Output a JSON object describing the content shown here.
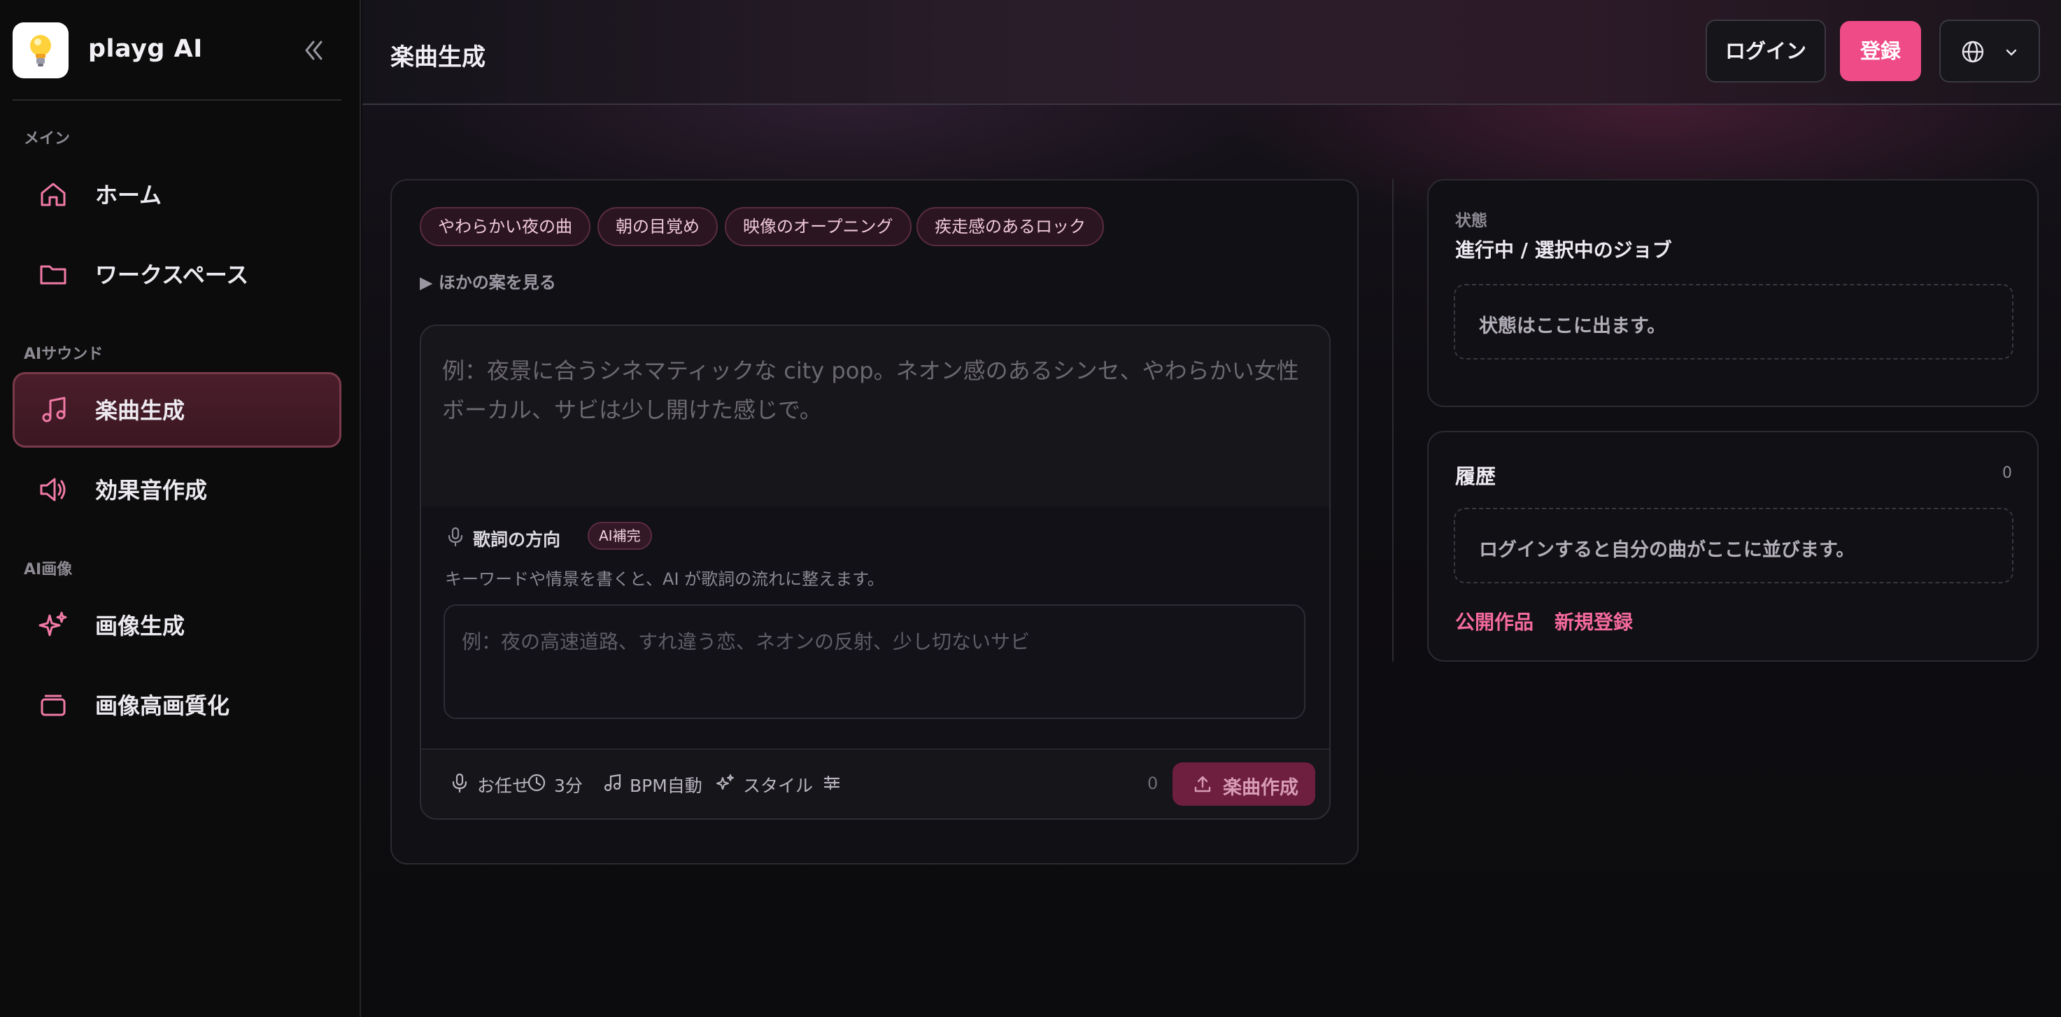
{
  "app": {
    "name": "playg AI"
  },
  "sidebar": {
    "sections": {
      "main": "メイン",
      "sound": "AIサウンド",
      "image": "AI画像"
    },
    "items": {
      "home": "ホーム",
      "workspace": "ワークスペース",
      "music": "楽曲生成",
      "sfx": "効果音作成",
      "image_gen": "画像生成",
      "upscale": "画像高画質化"
    },
    "active_item": "music"
  },
  "header": {
    "title": "楽曲生成",
    "login": "ログイン",
    "register": "登録"
  },
  "composer": {
    "chips": [
      "やわらかい夜の曲",
      "朝の目覚め",
      "映像のオープニング",
      "疾走感のあるロック"
    ],
    "more_ideas": "▶ ほかの案を見る",
    "prompt_placeholder": "例：夜景に合うシネマティックな city pop。ネオン感のあるシンセ、やわらかい女性ボーカル、サビは少し開けた感じで。",
    "lyrics": {
      "title": "歌詞の方向",
      "badge": "AI補完",
      "description": "キーワードや情景を書くと、AI が歌詞の流れに整えます。",
      "placeholder": "例：夜の高速道路、すれ違う恋、ネオンの反射、少し切ないサビ"
    },
    "toolbar": {
      "vocal": "お任せ",
      "duration": "3分",
      "bpm": "BPM自動",
      "style": "スタイル",
      "char_count": "0",
      "create": "楽曲作成"
    }
  },
  "status_panel": {
    "label": "状態",
    "title": "進行中 / 選択中のジョブ",
    "placeholder": "状態はここに出ます。"
  },
  "history_panel": {
    "title": "履歴",
    "count": "0",
    "empty": "ログインすると自分の曲がここに並びます。",
    "links": {
      "public": "公開作品",
      "signup": "新規登録"
    }
  },
  "colors": {
    "accent": "#ef4b86",
    "link": "#f46a9c",
    "active_nav_bg": "#4a1e2a",
    "chip_bg": "#2a1520"
  }
}
